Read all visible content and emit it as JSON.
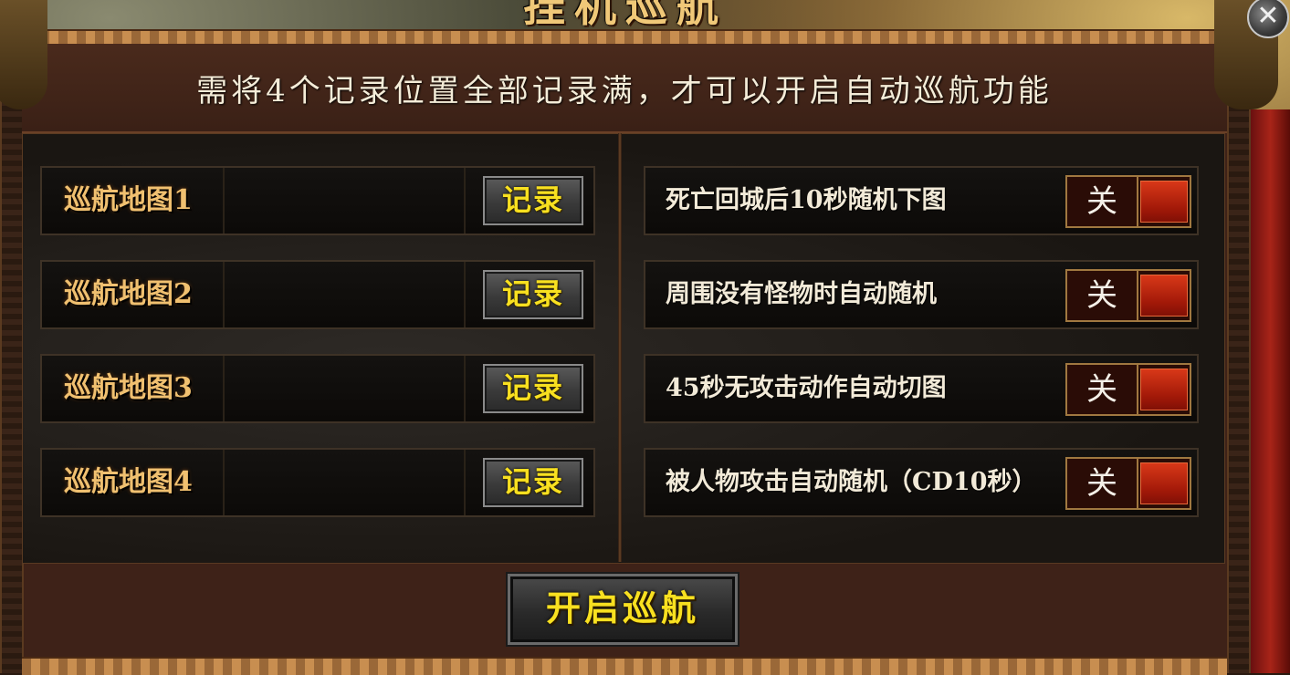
{
  "window": {
    "title": "挂机巡航",
    "close_symbol": "✕"
  },
  "instruction": "需将4个记录位置全部记录满，才可以开启自动巡航功能",
  "maps": [
    {
      "label": "巡航地图1",
      "button": "记录"
    },
    {
      "label": "巡航地图2",
      "button": "记录"
    },
    {
      "label": "巡航地图3",
      "button": "记录"
    },
    {
      "label": "巡航地图4",
      "button": "记录"
    }
  ],
  "options": [
    {
      "label": "死亡回城后10秒随机下图",
      "state": "关"
    },
    {
      "label": "周围没有怪物时自动随机",
      "state": "关"
    },
    {
      "label": "45秒无攻击动作自动切图",
      "state": "关"
    },
    {
      "label": "被人物攻击自动随机（CD10秒）",
      "state": "关"
    }
  ],
  "start_button": "开启巡航",
  "colors": {
    "accent_gold": "#f8e020",
    "toggle_off": "#c02810",
    "panel_brown": "#3e2218"
  }
}
